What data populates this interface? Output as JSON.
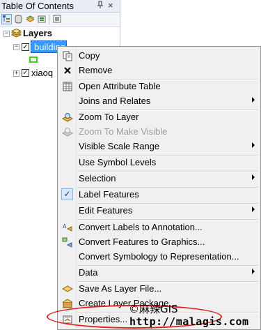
{
  "toc": {
    "title": "Table Of Contents",
    "pin_glyph": "ᵖ",
    "close_glyph": "×",
    "toolbar": [
      "list-by-drawing-order-icon",
      "list-by-source-icon",
      "list-by-visibility-icon",
      "list-by-selection-icon",
      "options-icon"
    ],
    "layers_label": "Layers",
    "layers": [
      {
        "name": "buildings",
        "checked": true,
        "selected": true,
        "expanded": true,
        "symbol_color": "#37d414"
      },
      {
        "name": "xiaoq",
        "checked": true,
        "selected": false,
        "expanded": false
      }
    ]
  },
  "menu": {
    "items": [
      {
        "label": "Copy",
        "icon": "copy-icon"
      },
      {
        "label": "Remove",
        "icon": "remove-icon"
      },
      {
        "label": "Open Attribute Table",
        "icon": "table-icon"
      },
      {
        "label": "Joins and Relates",
        "submenu": true
      },
      {
        "label": "Zoom To Layer",
        "icon": "zoom-to-layer-icon"
      },
      {
        "label": "Zoom To Make Visible",
        "icon": "zoom-visible-icon",
        "disabled": true
      },
      {
        "label": "Visible Scale Range",
        "submenu": true
      },
      {
        "label": "Use Symbol Levels"
      },
      {
        "label": "Selection",
        "submenu": true
      },
      {
        "label": "Label Features",
        "checked": true
      },
      {
        "label": "Edit Features",
        "submenu": true
      },
      {
        "label": "Convert Labels to Annotation...",
        "icon": "convert-labels-icon"
      },
      {
        "label": "Convert Features to Graphics...",
        "icon": "convert-features-icon"
      },
      {
        "label": "Convert Symbology to Representation..."
      },
      {
        "label": "Data",
        "submenu": true
      },
      {
        "label": "Save As Layer File...",
        "icon": "layer-file-icon"
      },
      {
        "label": "Create Layer Package...",
        "icon": "layer-package-icon"
      },
      {
        "label": "Properties...",
        "icon": "properties-icon"
      }
    ]
  },
  "watermark": {
    "text": "©麻辣GIS",
    "url": "http://malagis.com"
  },
  "colors": {
    "selection": "#3399ff",
    "highlight_ring": "#e0201b"
  }
}
